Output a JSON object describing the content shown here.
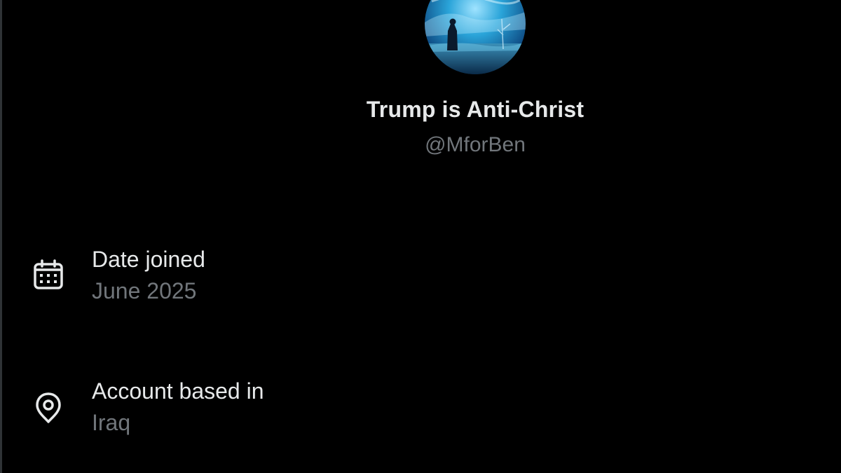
{
  "profile": {
    "display_name": "Trump is Anti-Christ",
    "handle": "@MforBen",
    "avatar_icon": "profile-avatar-night-sky"
  },
  "details": [
    {
      "icon": "calendar-icon",
      "label": "Date joined",
      "value": "June 2025"
    },
    {
      "icon": "location-pin-icon",
      "label": "Account based in",
      "value": "Iraq"
    }
  ],
  "colors": {
    "background": "#000000",
    "primary_text": "#e7e9ea",
    "secondary_text": "#71767b"
  }
}
